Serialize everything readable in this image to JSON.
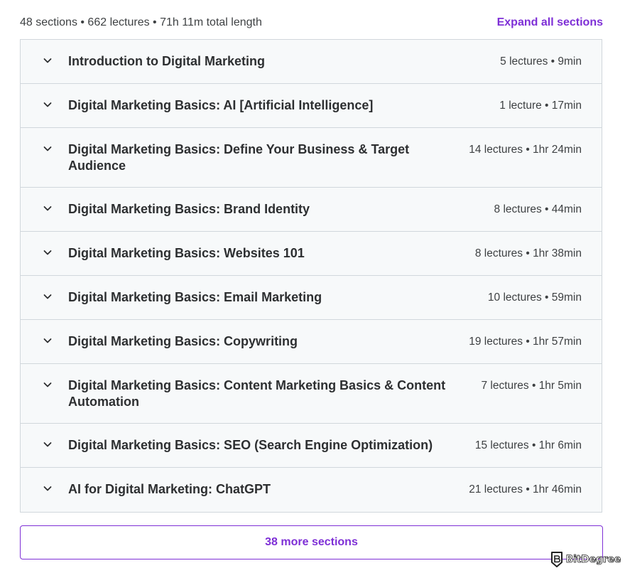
{
  "header": {
    "summary": "48 sections • 662 lectures • 71h 11m total length",
    "expand_label": "Expand all sections"
  },
  "sections": [
    {
      "title": "Introduction to Digital Marketing",
      "meta": "5 lectures • 9min"
    },
    {
      "title": "Digital Marketing Basics: AI [Artificial Intelligence]",
      "meta": "1 lecture • 17min"
    },
    {
      "title": "Digital Marketing Basics: Define Your Business & Target Audience",
      "meta": "14 lectures • 1hr 24min"
    },
    {
      "title": "Digital Marketing Basics: Brand Identity",
      "meta": "8 lectures • 44min"
    },
    {
      "title": "Digital Marketing Basics: Websites 101",
      "meta": "8 lectures • 1hr 38min"
    },
    {
      "title": "Digital Marketing Basics: Email Marketing",
      "meta": "10 lectures • 59min"
    },
    {
      "title": "Digital Marketing Basics: Copywriting",
      "meta": "19 lectures • 1hr 57min"
    },
    {
      "title": "Digital Marketing Basics: Content Marketing Basics & Content Automation",
      "meta": "7 lectures • 1hr 5min"
    },
    {
      "title": "Digital Marketing Basics: SEO (Search Engine Optimization)",
      "meta": "15 lectures • 1hr 6min"
    },
    {
      "title": "AI for Digital Marketing: ChatGPT",
      "meta": "21 lectures • 1hr 46min"
    }
  ],
  "more_button": {
    "label": "38 more sections"
  },
  "watermark": {
    "text": "BitDegree"
  },
  "colors": {
    "accent": "#7e2fd6",
    "row_background": "#f7f9fa",
    "border": "#d1d7dc",
    "text": "#2d2f31"
  },
  "icons": {
    "row_icon": "chevron-down-icon",
    "watermark_icon": "bitdegree-logo-icon"
  }
}
